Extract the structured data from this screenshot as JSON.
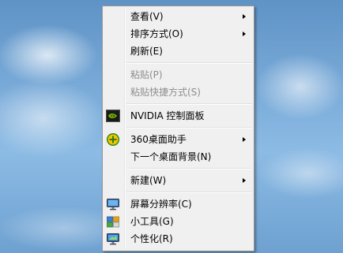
{
  "context_menu": {
    "items": [
      {
        "label": "查看(V)",
        "submenu": true
      },
      {
        "label": "排序方式(O)",
        "submenu": true
      },
      {
        "label": "刷新(E)"
      },
      {
        "label": "粘贴(P)",
        "disabled": true
      },
      {
        "label": "粘贴快捷方式(S)",
        "disabled": true
      },
      {
        "label": "NVIDIA 控制面板",
        "icon": "nvidia-icon"
      },
      {
        "label": "360桌面助手",
        "icon": "360-icon",
        "submenu": true
      },
      {
        "label": "下一个桌面背景(N)"
      },
      {
        "label": "新建(W)",
        "submenu": true
      },
      {
        "label": "屏幕分辨率(C)",
        "icon": "monitor-icon"
      },
      {
        "label": "小工具(G)",
        "icon": "gadgets-icon"
      },
      {
        "label": "个性化(R)",
        "icon": "personalize-icon"
      }
    ]
  },
  "colors": {
    "menu_bg": "#f0f0f0",
    "disabled_text": "#8d8d8d",
    "nvidia_green": "#76b900",
    "desktop_blue": "#79aad8"
  }
}
